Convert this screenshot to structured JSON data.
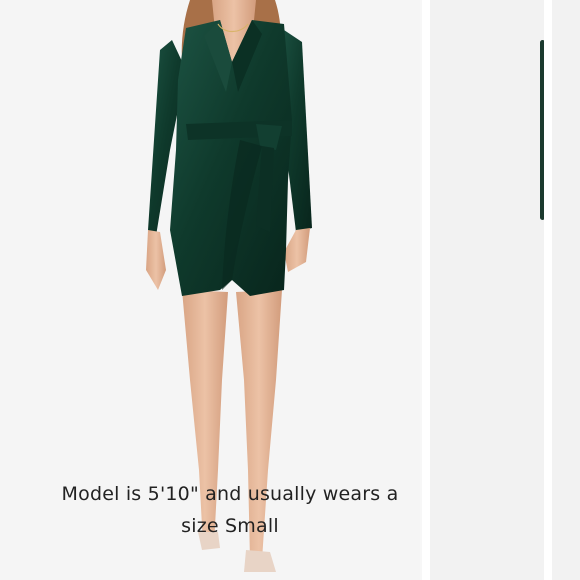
{
  "product_image": {
    "alt": "green velvet wrap dress model photo",
    "dress_color": "#0f3a2c",
    "skin_color": "#e3b59b",
    "hair_color": "#a87048",
    "background_color": "#f5f5f5"
  },
  "caption": {
    "line1": "Model is 5'10\" and usually wears a",
    "line2": "size Small",
    "color": "#222222"
  }
}
